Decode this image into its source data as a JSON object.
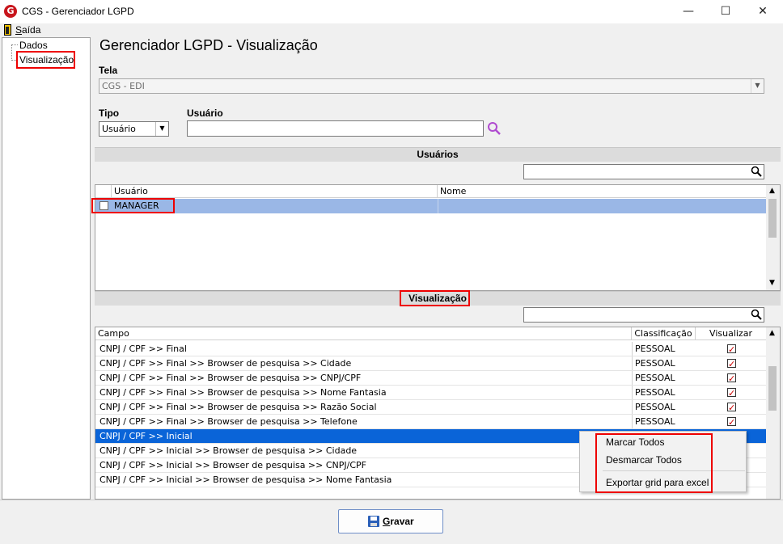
{
  "window": {
    "title": "CGS - Gerenciador LGPD",
    "app_icon_letter": "G"
  },
  "menu": {
    "saida_first": "S",
    "saida_rest": "aída"
  },
  "tree": {
    "items": [
      {
        "label": "Dados"
      },
      {
        "label": "Visualização"
      }
    ]
  },
  "page": {
    "title": "Gerenciador LGPD - Visualização"
  },
  "tela": {
    "label": "Tela",
    "value": "CGS - EDI"
  },
  "tipo": {
    "label": "Tipo",
    "value": "Usuário"
  },
  "usuario_filter": {
    "label": "Usuário",
    "value": ""
  },
  "usuarios_section": {
    "title": "Usuários",
    "search_value": "",
    "columns": [
      "Usuário",
      "Nome"
    ],
    "rows": [
      {
        "usuario": "MANAGER",
        "nome": "",
        "checked": false
      }
    ]
  },
  "visualizacao_section": {
    "title": "Visualização",
    "search_value": "",
    "columns": [
      "Campo",
      "Classificação",
      "Visualizar"
    ],
    "rows": [
      {
        "campo": "CNPJ / CPF >> Final",
        "classificacao": "PESSOAL",
        "visualizar": true
      },
      {
        "campo": "CNPJ / CPF >> Final >> Browser de pesquisa >> Cidade",
        "classificacao": "PESSOAL",
        "visualizar": true
      },
      {
        "campo": "CNPJ / CPF >> Final >> Browser de pesquisa >> CNPJ/CPF",
        "classificacao": "PESSOAL",
        "visualizar": true
      },
      {
        "campo": "CNPJ / CPF >> Final >> Browser de pesquisa >> Nome Fantasia",
        "classificacao": "PESSOAL",
        "visualizar": true
      },
      {
        "campo": "CNPJ / CPF >> Final >> Browser de pesquisa >> Razão Social",
        "classificacao": "PESSOAL",
        "visualizar": true
      },
      {
        "campo": "CNPJ / CPF >> Final >> Browser de pesquisa >> Telefone",
        "classificacao": "PESSOAL",
        "visualizar": true
      },
      {
        "campo": "CNPJ / CPF >> Inicial",
        "classificacao": "",
        "visualizar": null,
        "selected": true
      },
      {
        "campo": "CNPJ / CPF >> Inicial >> Browser de pesquisa >> Cidade",
        "classificacao": "",
        "visualizar": null
      },
      {
        "campo": "CNPJ / CPF >> Inicial >> Browser de pesquisa >> CNPJ/CPF",
        "classificacao": "",
        "visualizar": null
      },
      {
        "campo": "CNPJ / CPF >> Inicial >> Browser de pesquisa >> Nome Fantasia",
        "classificacao": "",
        "visualizar": null
      }
    ]
  },
  "context_menu": {
    "items": [
      "Marcar Todos",
      "Desmarcar Todos",
      "Exportar grid para excel"
    ]
  },
  "buttons": {
    "gravar_first": "G",
    "gravar_rest": "ravar"
  },
  "colors": {
    "highlight": "#e00000",
    "selection": "#0a64d8",
    "check": "#cc0000"
  }
}
